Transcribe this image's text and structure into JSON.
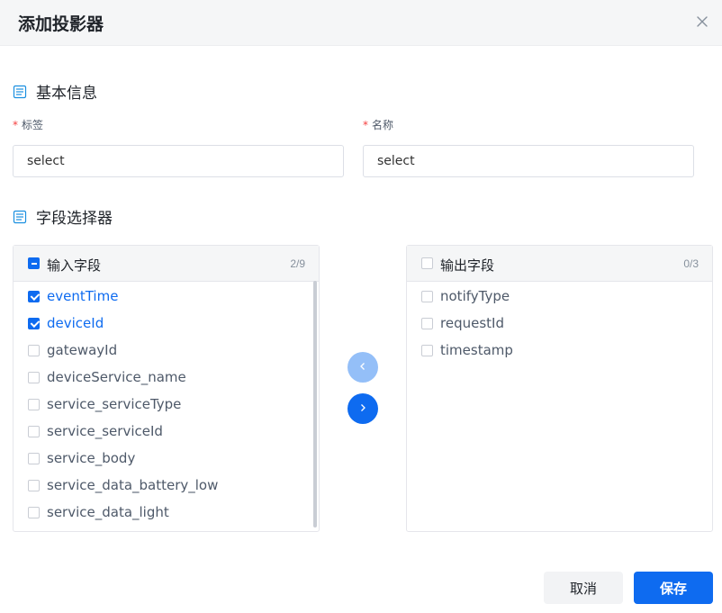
{
  "dialog": {
    "title": "添加投影器"
  },
  "basic_section": {
    "title": "基本信息",
    "label_field": {
      "required_mark": "*",
      "label": "标签",
      "value": "select"
    },
    "name_field": {
      "required_mark": "*",
      "label": "名称",
      "value": "select"
    }
  },
  "selector_section": {
    "title": "字段选择器"
  },
  "input_panel": {
    "title": "输入字段",
    "count": "2/9",
    "items": [
      {
        "label": "eventTime",
        "checked": true
      },
      {
        "label": "deviceId",
        "checked": true
      },
      {
        "label": "gatewayId",
        "checked": false
      },
      {
        "label": "deviceService_name",
        "checked": false
      },
      {
        "label": "service_serviceType",
        "checked": false
      },
      {
        "label": "service_serviceId",
        "checked": false
      },
      {
        "label": "service_body",
        "checked": false
      },
      {
        "label": "service_data_battery_low",
        "checked": false
      },
      {
        "label": "service_data_light",
        "checked": false
      }
    ]
  },
  "output_panel": {
    "title": "输出字段",
    "count": "0/3",
    "items": [
      {
        "label": "notifyType",
        "checked": false
      },
      {
        "label": "requestId",
        "checked": false
      },
      {
        "label": "timestamp",
        "checked": false
      }
    ]
  },
  "footer": {
    "cancel_label": "取消",
    "save_label": "保存"
  },
  "colors": {
    "primary": "#0e6bf0",
    "primary_disabled": "#94bff8",
    "required": "#f53f3f",
    "section_icon": "#1a8fe0"
  }
}
